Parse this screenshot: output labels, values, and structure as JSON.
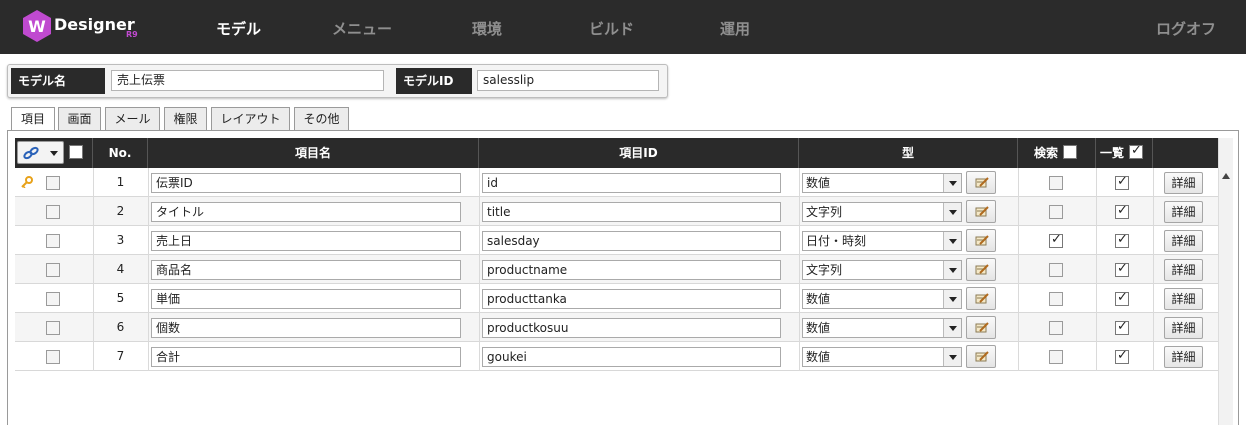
{
  "app": {
    "logo_text": "Designer",
    "logo_version": "R9"
  },
  "nav": {
    "model": "モデル",
    "menu": "メニュー",
    "environment": "環境",
    "build": "ビルド",
    "operation": "運用",
    "logoff": "ログオフ"
  },
  "model": {
    "name_label": "モデル名",
    "name_value": "売上伝票",
    "id_label": "モデルID",
    "id_value": "salesslip"
  },
  "tabs": [
    "項目",
    "画面",
    "メール",
    "権限",
    "レイアウト",
    "その他"
  ],
  "grid": {
    "headers": {
      "no": "No.",
      "item_name": "項目名",
      "item_id": "項目ID",
      "type": "型",
      "search": "検索",
      "list": "一覧"
    },
    "header_list_checked": true,
    "detail_label": "詳細",
    "rows": [
      {
        "no": "1",
        "name": "伝票ID",
        "id": "id",
        "type": "数値",
        "search": false,
        "list": true,
        "key": true
      },
      {
        "no": "2",
        "name": "タイトル",
        "id": "title",
        "type": "文字列",
        "search": false,
        "list": true,
        "key": false
      },
      {
        "no": "3",
        "name": "売上日",
        "id": "salesday",
        "type": "日付・時刻",
        "search": true,
        "list": true,
        "key": false
      },
      {
        "no": "4",
        "name": "商品名",
        "id": "productname",
        "type": "文字列",
        "search": false,
        "list": true,
        "key": false
      },
      {
        "no": "5",
        "name": "単価",
        "id": "producttanka",
        "type": "数値",
        "search": false,
        "list": true,
        "key": false
      },
      {
        "no": "6",
        "name": "個数",
        "id": "productkosuu",
        "type": "数値",
        "search": false,
        "list": true,
        "key": false
      },
      {
        "no": "7",
        "name": "合計",
        "id": "goukei",
        "type": "数値",
        "search": false,
        "list": true,
        "key": false
      }
    ]
  },
  "colors": {
    "topbar_bg": "#2b2b2b",
    "header_bg": "#2a2a2a",
    "nav_active": "#ffffff",
    "nav_inactive": "#8f8f8f",
    "key_icon": "#e8a21a",
    "logo_accent": "#c04ad0"
  }
}
